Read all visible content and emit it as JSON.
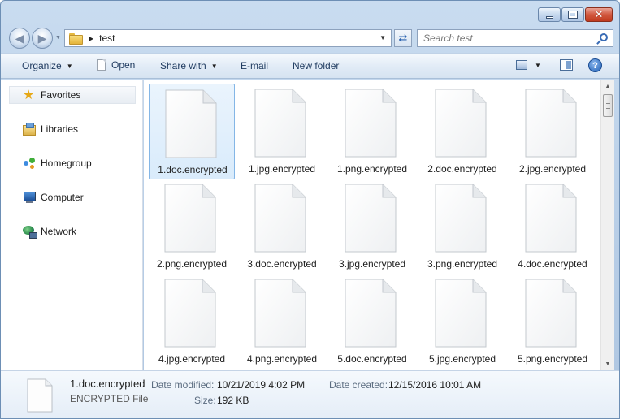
{
  "window": {
    "caption_icons": [
      "minimize-icon",
      "maximize-icon",
      "close-icon"
    ],
    "close_glyph": "✕"
  },
  "address_bar": {
    "breadcrumb": [
      "test"
    ],
    "search_placeholder": "Search test"
  },
  "toolbar": {
    "organize_label": "Organize",
    "open_label": "Open",
    "share_with_label": "Share with",
    "email_label": "E-mail",
    "new_folder_label": "New folder",
    "help_glyph": "?"
  },
  "sidebar": {
    "items": [
      {
        "label": "Favorites",
        "icon": "star-icon"
      },
      {
        "label": "Libraries",
        "icon": "libraries-icon"
      },
      {
        "label": "Homegroup",
        "icon": "homegroup-icon"
      },
      {
        "label": "Computer",
        "icon": "computer-icon"
      },
      {
        "label": "Network",
        "icon": "network-icon"
      }
    ]
  },
  "files": [
    {
      "name": "1.doc.encrypted",
      "selected": true
    },
    {
      "name": "1.jpg.encrypted"
    },
    {
      "name": "1.png.encrypted"
    },
    {
      "name": "2.doc.encrypted"
    },
    {
      "name": "2.jpg.encrypted"
    },
    {
      "name": "2.png.encrypted"
    },
    {
      "name": "3.doc.encrypted"
    },
    {
      "name": "3.jpg.encrypted"
    },
    {
      "name": "3.png.encrypted"
    },
    {
      "name": "4.doc.encrypted"
    },
    {
      "name": "4.jpg.encrypted"
    },
    {
      "name": "4.png.encrypted"
    },
    {
      "name": "5.doc.encrypted"
    },
    {
      "name": "5.jpg.encrypted"
    },
    {
      "name": "5.png.encrypted"
    }
  ],
  "details": {
    "name": "1.doc.encrypted",
    "type": "ENCRYPTED File",
    "date_modified_label": "Date modified:",
    "date_modified": "10/21/2019 4:02 PM",
    "size_label": "Size:",
    "size": "192 KB",
    "date_created_label": "Date created:",
    "date_created": "12/15/2016 10:01 AM"
  }
}
